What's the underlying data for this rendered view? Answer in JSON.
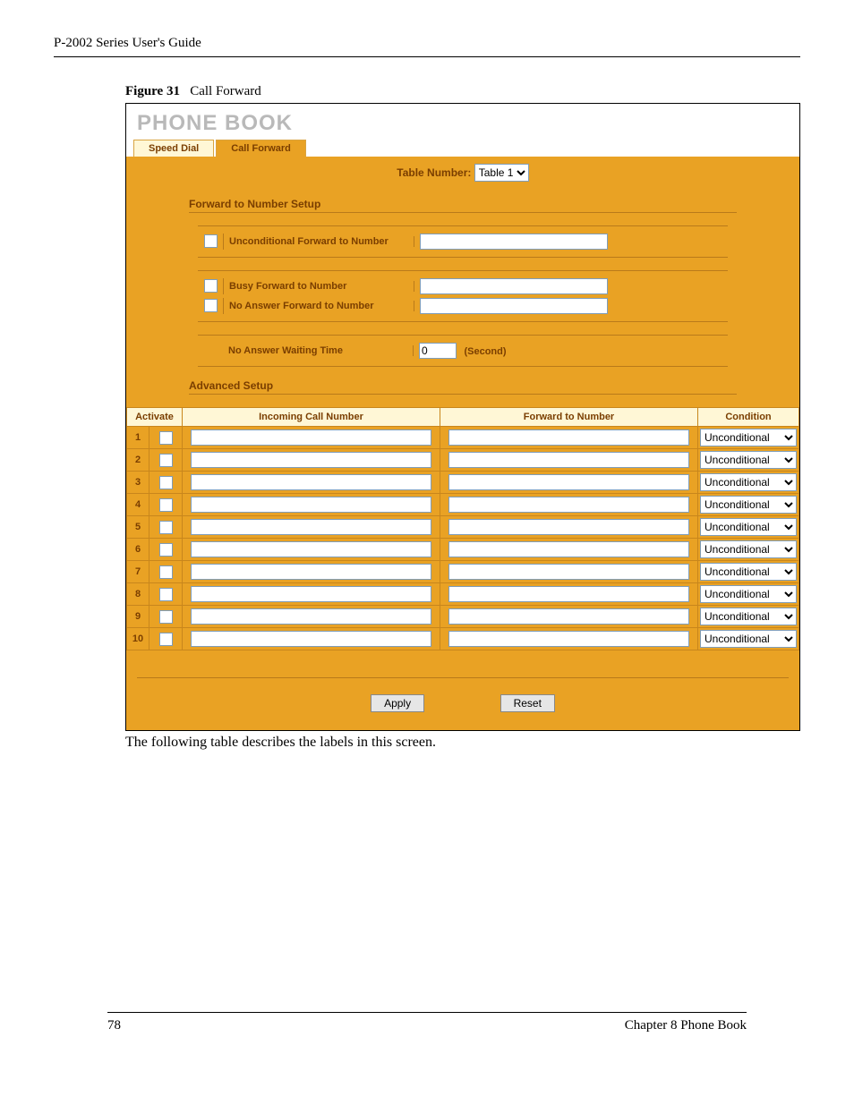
{
  "doc": {
    "header": "P-2002 Series User's Guide",
    "figure_label": "Figure 31",
    "figure_title": "Call Forward",
    "post_text": "The following table describes the labels in this screen.",
    "page_number": "78",
    "chapter": "Chapter 8 Phone Book"
  },
  "panel": {
    "title": "PHONE BOOK",
    "tabs": {
      "speed_dial": "Speed Dial",
      "call_forward": "Call Forward"
    },
    "table_number_label": "Table Number:",
    "table_number_value": "Table 1",
    "sections": {
      "forward_setup": "Forward to Number Setup",
      "advanced_setup": "Advanced Setup"
    },
    "forward_rows": {
      "unconditional": "Unconditional Forward to Number",
      "busy": "Busy Forward to Number",
      "noanswer": "No Answer Forward to Number",
      "wait_label": "No Answer Waiting Time",
      "wait_value": "0",
      "wait_unit": "(Second)"
    },
    "grid": {
      "headers": {
        "activate": "Activate",
        "incoming": "Incoming Call Number",
        "forward": "Forward to Number",
        "condition": "Condition"
      },
      "rows": [
        {
          "n": "1",
          "cond": "Unconditional"
        },
        {
          "n": "2",
          "cond": "Unconditional"
        },
        {
          "n": "3",
          "cond": "Unconditional"
        },
        {
          "n": "4",
          "cond": "Unconditional"
        },
        {
          "n": "5",
          "cond": "Unconditional"
        },
        {
          "n": "6",
          "cond": "Unconditional"
        },
        {
          "n": "7",
          "cond": "Unconditional"
        },
        {
          "n": "8",
          "cond": "Unconditional"
        },
        {
          "n": "9",
          "cond": "Unconditional"
        },
        {
          "n": "10",
          "cond": "Unconditional"
        }
      ]
    },
    "buttons": {
      "apply": "Apply",
      "reset": "Reset"
    }
  }
}
